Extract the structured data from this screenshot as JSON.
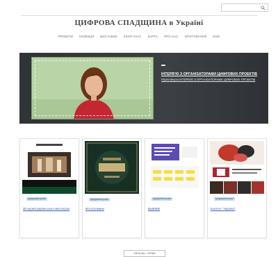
{
  "header": {
    "top_link": "",
    "search_placeholder": "",
    "site_title": "ЦИФРОВА СПАДЩИНА в Україні"
  },
  "nav": [
    "ПРОЕКТИ",
    "КОЛЕКЦІЇ",
    "ВИСТАВКИ",
    "ЛІНІЯ ЧАСУ",
    "КАРТА",
    "ПРО НАС",
    "ОПИТУВАННЯ",
    "ENG"
  ],
  "hero": {
    "badge": "",
    "title": "ІНТЕРВ'Ю З ОРГАНІЗАТОРАМИ ЦИФРОВИХ ПРОЕКТІВ",
    "subtitle": "Переглянути ІНТЕРВ'Ю З ОРГАНІЗАТОРАМИ ЦИФРОВИХ ПРОЕКТІВ"
  },
  "cards": [
    {
      "tags": [
        {
          "label": "",
          "color": "blue"
        },
        {
          "label": "Цифровий проект",
          "color": "blue"
        },
        {
          "label": "",
          "color": "blue"
        },
        {
          "label": "",
          "color": "purple"
        }
      ],
      "count": "",
      "title": "3D-музей українського мистецтва",
      "description": ""
    },
    {
      "tags": [
        {
          "label": "",
          "color": "blue"
        },
        {
          "label": "Цифровий проект",
          "color": "blue"
        },
        {
          "label": "",
          "color": "blue"
        },
        {
          "label": "",
          "color": "blue"
        }
      ],
      "count": "",
      "title": "Фотоспомини",
      "description": ""
    },
    {
      "tags": [
        {
          "label": "",
          "color": "blue"
        },
        {
          "label": "Цифровий проект",
          "color": "blue"
        },
        {
          "label": "",
          "color": "blue"
        },
        {
          "label": "",
          "color": "pink"
        }
      ],
      "count": "",
      "title": "ВЫВІВКІ",
      "description": ""
    },
    {
      "tags": [
        {
          "label": "",
          "color": "blue"
        },
        {
          "label": "Цифровий проект",
          "color": "blue"
        },
        {
          "label": "",
          "color": "blue"
        },
        {
          "label": "",
          "color": "green"
        }
      ],
      "count": "",
      "title": "Контент \"Україна\"",
      "description": ""
    }
  ],
  "view_all_label": "VIEW ALL ITEMS",
  "colors": {
    "hero_bg": "#33373c",
    "accent_link": "#3b5fa8",
    "tag_blue": "#c8dcf2",
    "tag_green": "#cfe8c9",
    "tag_purple": "#ddd3ef",
    "tag_pink": "#f4cdd8"
  }
}
